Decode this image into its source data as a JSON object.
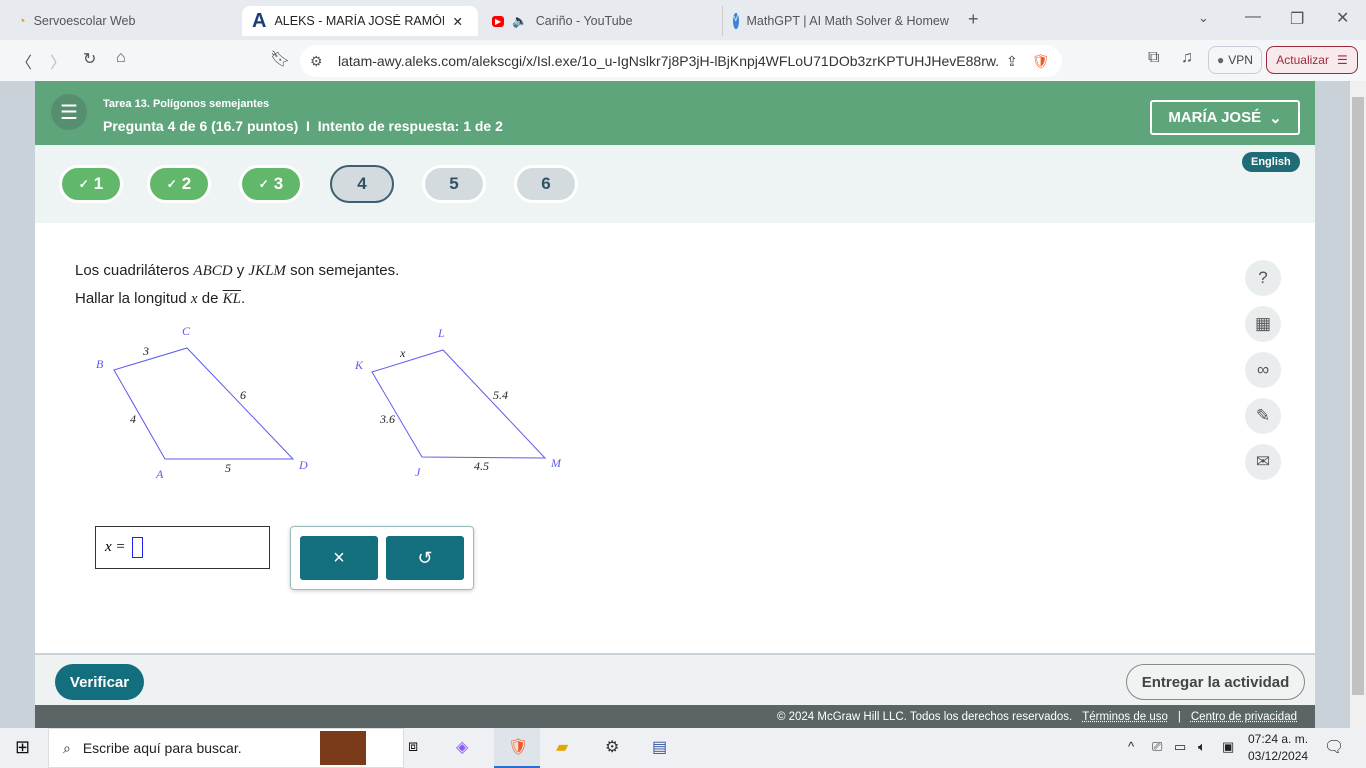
{
  "browser": {
    "tabs": [
      {
        "label": "Servoescolar Web"
      },
      {
        "label": "ALEKS - MARÍA JOSÉ RAMÓN M"
      },
      {
        "label": "Cariño - YouTube"
      },
      {
        "label": "MathGPT | AI Math Solver & Homew"
      }
    ],
    "url": "latam-awy.aleks.com/alekscgi/x/Isl.exe/1o_u-IgNslkr7j8P3jH-lBjKnpj4WFLoU71DOb3zrKPTUHJHevE88rw...",
    "vpn": "VPN",
    "update": "Actualizar"
  },
  "header": {
    "assignment": "Tarea 13. Polígonos semejantes",
    "question": "Pregunta 4 de 6 (16.7 puntos)",
    "attempt": "Intento de respuesta: 1 de 2",
    "user": "MARÍA JOSÉ",
    "language": "English"
  },
  "questions": [
    {
      "n": "1",
      "status": "done"
    },
    {
      "n": "2",
      "status": "done"
    },
    {
      "n": "3",
      "status": "done"
    },
    {
      "n": "4",
      "status": "current"
    },
    {
      "n": "5",
      "status": "todo"
    },
    {
      "n": "6",
      "status": "todo"
    }
  ],
  "problem": {
    "line1_a": "Los cuadriláteros ",
    "q1": "ABCD",
    "line1_b": " y ",
    "q2": "JKLM",
    "line1_c": " son semejantes.",
    "line2_a": "Hallar la longitud ",
    "var": "x",
    "line2_b": " de ",
    "seg": "KL",
    "line2_c": "."
  },
  "figure1": {
    "labels": {
      "A": "A",
      "B": "B",
      "C": "C",
      "D": "D"
    },
    "sides": {
      "BC": "3",
      "CD": "6",
      "AB": "4",
      "AD": "5"
    }
  },
  "figure2": {
    "labels": {
      "J": "J",
      "K": "K",
      "L": "L",
      "M": "M"
    },
    "sides": {
      "KL": "x",
      "LM": "5.4",
      "JK": "3.6",
      "JM": "4.5"
    }
  },
  "answer": {
    "label": "x =",
    "value": ""
  },
  "buttons": {
    "clear": "×",
    "undo": "↺",
    "check": "Verificar",
    "submit": "Entregar la actividad"
  },
  "footer": {
    "copyright": "© 2024 McGraw Hill LLC. Todos los derechos reservados.",
    "terms": "Términos de uso",
    "privacy": "Centro de privacidad"
  },
  "taskbar": {
    "search": "Escribe aquí para buscar.",
    "time": "07:24 a. m.",
    "date": "03/12/2024"
  },
  "colors": {
    "header": "#5fa57c",
    "done": "#62b86a",
    "primary": "#136f7e",
    "figure": "#5b5bf0"
  }
}
